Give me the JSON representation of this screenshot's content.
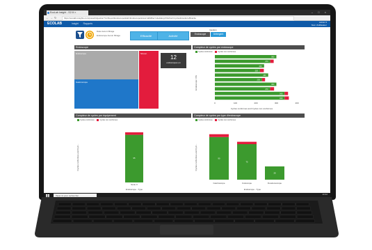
{
  "browser": {
    "tab_title": "EcoLab Insight - S2 III ×",
    "url": "https://ecolab.insights.com/powerbi/gestion?rs=ReportEndoscope&tab=Endoscope&view=all&filter=site&lang=fr&chart=cycles&mode=efficacite"
  },
  "app": {
    "brand": "ECOLAB",
    "nav": [
      "Insight",
      "Rapports"
    ],
    "user_line1": "Admin  ▾",
    "user_line2": "Nom d'utilisateur",
    "accent": "#0f5aa8"
  },
  "filters": {
    "text_line1": "Date  Aucun filtrage",
    "text_line2": "Endoscope    Aucun filtrage",
    "efficacite_label": "Efficacité",
    "activite_label": "Activité",
    "gestion_label": "Gestion",
    "tab_endoscope": "Endoscope",
    "tab_detergent": "Détergent"
  },
  "kpi": {
    "value": "12",
    "label": "endoscopes en"
  },
  "panels": {
    "endoscope": {
      "title": "Endoscope",
      "tiles": [
        "Endoscope",
        "Gastroscope",
        "Sinusc."
      ]
    },
    "compteur_endoscope": {
      "title": "Compteur de cycles par endoscope",
      "legend": [
        "Cycles conformes",
        "Cycles non conformes"
      ],
      "ylabel": "Endoscope / NS",
      "xlabel": "Cycles conformes and Cycles non conformes",
      "xticks": [
        "0",
        "100",
        "200",
        "300",
        "400"
      ]
    },
    "compteur_equipement": {
      "title": "Compteur de cycles par équipement",
      "legend": [
        "Cycles conformes",
        "Cycles non conformes"
      ],
      "ylabel": "Cycles conformes and Cycl...",
      "xlabel": "Endoscope - Type",
      "category": "Serie X"
    },
    "compteur_type": {
      "title": "Compteur de cycles par type d'endoscope",
      "legend": [
        "Cycles conformes",
        "Cycles non conformes"
      ],
      "ylabel": "Cycles conformes and Cycl...",
      "xlabel": "Endoscope - Type",
      "categories": [
        "Gastroscope",
        "Coloscope",
        "Duodenoscope",
        "Bronchoscope"
      ]
    }
  },
  "taskbar": {
    "search_placeholder": "Taper ici pour rechercher",
    "time": "10:42",
    "date": "12/03/2020"
  },
  "chart_data": [
    {
      "type": "bar",
      "title": "Compteur de cycles par endoscope",
      "orientation": "horizontal",
      "xlabel": "Cycles conformes and Cycles non conformes",
      "ylabel": "Endoscope / NS",
      "xlim": [
        0,
        400
      ],
      "series": [
        {
          "name": "Cycles conformes",
          "color": "#3c9a2e",
          "values": [
            300,
            270,
            240,
            220,
            260,
            230,
            300,
            270,
            340,
            340
          ]
        },
        {
          "name": "Cycles non conformes",
          "color": "#e31c3d",
          "values": [
            0,
            10,
            0,
            12,
            0,
            8,
            0,
            12,
            10,
            14
          ]
        }
      ],
      "bar_labels": [
        "300",
        "270",
        "240",
        "220",
        "260",
        "230",
        "300",
        "270",
        "340",
        "340"
      ]
    },
    {
      "type": "bar",
      "title": "Compteur de cycles par équipement",
      "xlabel": "Endoscope - Type",
      "ylabel": "Cycles conformes and Cycl...",
      "categories": [
        "Serie X"
      ],
      "series": [
        {
          "name": "Cycles conformes",
          "color": "#3c9a2e",
          "values": [
            95
          ]
        },
        {
          "name": "Cycles non conformes",
          "color": "#e31c3d",
          "values": [
            5
          ]
        }
      ],
      "bar_labels": [
        "95"
      ]
    },
    {
      "type": "bar",
      "title": "Compteur de cycles par type d'endoscope",
      "xlabel": "Endoscope - Type",
      "ylabel": "Cycles conformes and Cycl...",
      "categories": [
        "Gastroscope",
        "Coloscope",
        "Duodenoscope"
      ],
      "series": [
        {
          "name": "Cycles conformes",
          "color": "#3c9a2e",
          "values": [
            90,
            75,
            28
          ]
        },
        {
          "name": "Cycles non conformes",
          "color": "#e31c3d",
          "values": [
            6,
            5,
            0
          ]
        }
      ],
      "bar_labels": [
        "90",
        "75",
        "28"
      ]
    }
  ]
}
